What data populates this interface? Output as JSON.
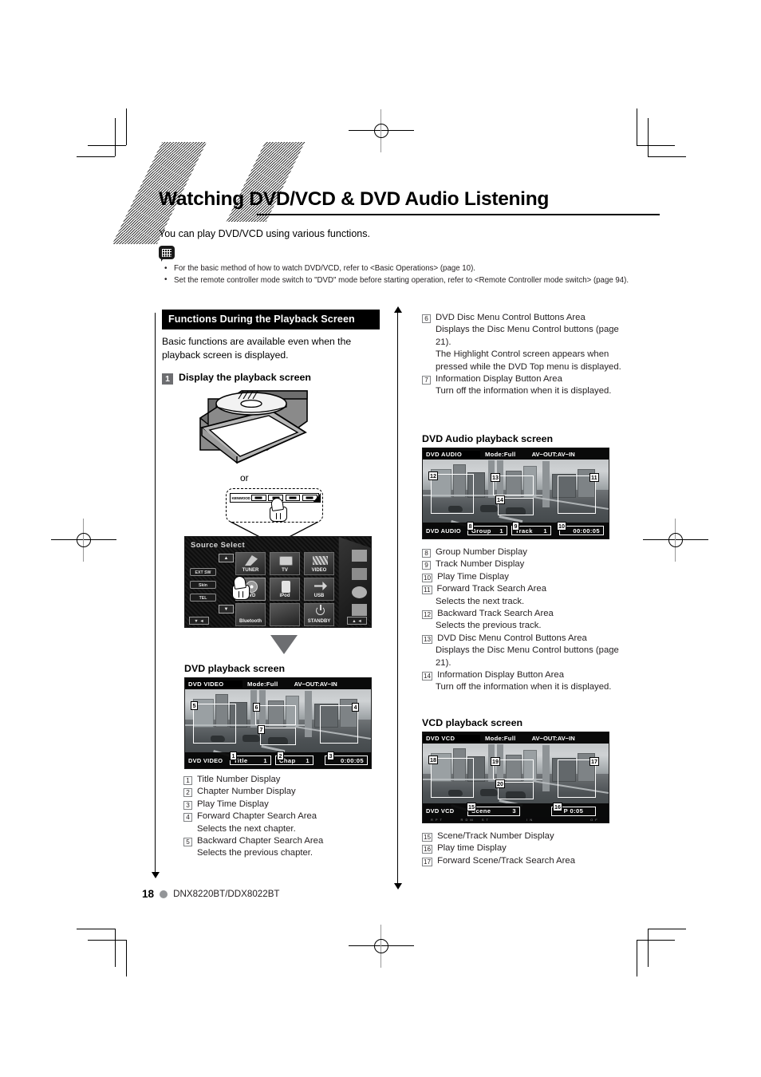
{
  "header": {
    "title": "Watching DVD/VCD & DVD Audio Listening",
    "intro": "You can play DVD/VCD using various functions.",
    "note_icon": "note-grid-icon",
    "notes": [
      "For the basic method of how to watch DVD/VCD, refer to <Basic Operations> (page 10).",
      "Set the remote controller mode switch to \"DVD\" mode before starting operation, refer to <Remote Controller mode switch> (page 94)."
    ]
  },
  "left": {
    "section_heading": "Functions During the Playback Screen",
    "section_body": "Basic functions are available even when the playback screen is displayed.",
    "step_number": "1",
    "step_label": "Display the playback screen",
    "or_label": "or",
    "faceplate_brand": "KENWOOD",
    "source_select": {
      "title": "Source Select",
      "side_buttons": [
        "EXT SW",
        "Skin",
        "TEL"
      ],
      "tiles": [
        "TUNER",
        "TV",
        "VIDEO",
        "DVD",
        "iPod",
        "USB",
        "Bluetooth",
        "",
        "STANDBY"
      ],
      "up_arrow": "▲",
      "down_arrow": "▼"
    },
    "dvd_screen": {
      "caption": "DVD playback screen",
      "source": "DVD VIDEO",
      "mode": "Mode:Full",
      "avio": "AV−OUT:AV−IN",
      "bottom_source": "DVD VIDEO",
      "title_label": "Title",
      "title_value": "1",
      "chapter_label": "Chap",
      "chapter_value": "1",
      "time_value": "0:00:05",
      "regions": [
        "1",
        "2",
        "3",
        "4",
        "5",
        "6",
        "7"
      ]
    },
    "list": [
      {
        "n": "1",
        "t": "Title Number Display"
      },
      {
        "n": "2",
        "t": "Chapter Number Display"
      },
      {
        "n": "3",
        "t": "Play Time Display"
      },
      {
        "n": "4",
        "t": "Forward Chapter Search Area",
        "sub": "Selects the next chapter."
      },
      {
        "n": "5",
        "t": "Backward Chapter Search Area",
        "sub": "Selects the previous chapter."
      }
    ]
  },
  "right": {
    "list_top": [
      {
        "n": "6",
        "t": "DVD Disc Menu Control Buttons Area",
        "sub": "Displays the Disc Menu Control buttons (page 21).\nThe Highlight Control screen appears when pressed while the DVD Top menu is displayed."
      },
      {
        "n": "7",
        "t": "Information Display Button Area",
        "sub": "Turn off the information when it is displayed."
      }
    ],
    "audio_screen": {
      "caption": "DVD Audio playback screen",
      "source": "DVD AUDIO",
      "mode": "Mode:Full",
      "avio": "AV−OUT:AV−IN",
      "bottom_source": "DVD AUDIO",
      "group_label": "Group",
      "group_value": "1",
      "track_label": "Track",
      "track_value": "1",
      "time_value": "00:00:05",
      "regions": [
        "8",
        "9",
        "10",
        "11",
        "12",
        "13",
        "14"
      ]
    },
    "list_mid": [
      {
        "n": "8",
        "t": "Group Number Display"
      },
      {
        "n": "9",
        "t": "Track Number Display"
      },
      {
        "n": "10",
        "t": "Play Time Display"
      },
      {
        "n": "11",
        "t": "Forward Track Search Area",
        "sub": "Selects the next track."
      },
      {
        "n": "12",
        "t": "Backward Track Search Area",
        "sub": "Selects the previous track."
      },
      {
        "n": "13",
        "t": "DVD Disc Menu Control Buttons Area",
        "sub": "Displays the Disc Menu Control buttons (page 21)."
      },
      {
        "n": "14",
        "t": "Information Display Button Area",
        "sub": "Turn off the information when it is displayed."
      }
    ],
    "vcd_screen": {
      "caption": "VCD playback screen",
      "source": "DVD VCD",
      "mode": "Mode:Full",
      "avio": "AV−OUT:AV−IN",
      "bottom_source": "DVD VCD",
      "scene_label": "Scene",
      "scene_value": "3",
      "time_value": "P   0:05",
      "regions": [
        "15",
        "16",
        "17",
        "18",
        "19",
        "20"
      ]
    },
    "list_bottom": [
      {
        "n": "15",
        "t": "Scene/Track Number Display"
      },
      {
        "n": "16",
        "t": "Play time Display"
      },
      {
        "n": "17",
        "t": "Forward Scene/Track Search Area"
      }
    ]
  },
  "footer": {
    "page_number": "18",
    "model": "DNX8220BT/DDX8022BT"
  }
}
